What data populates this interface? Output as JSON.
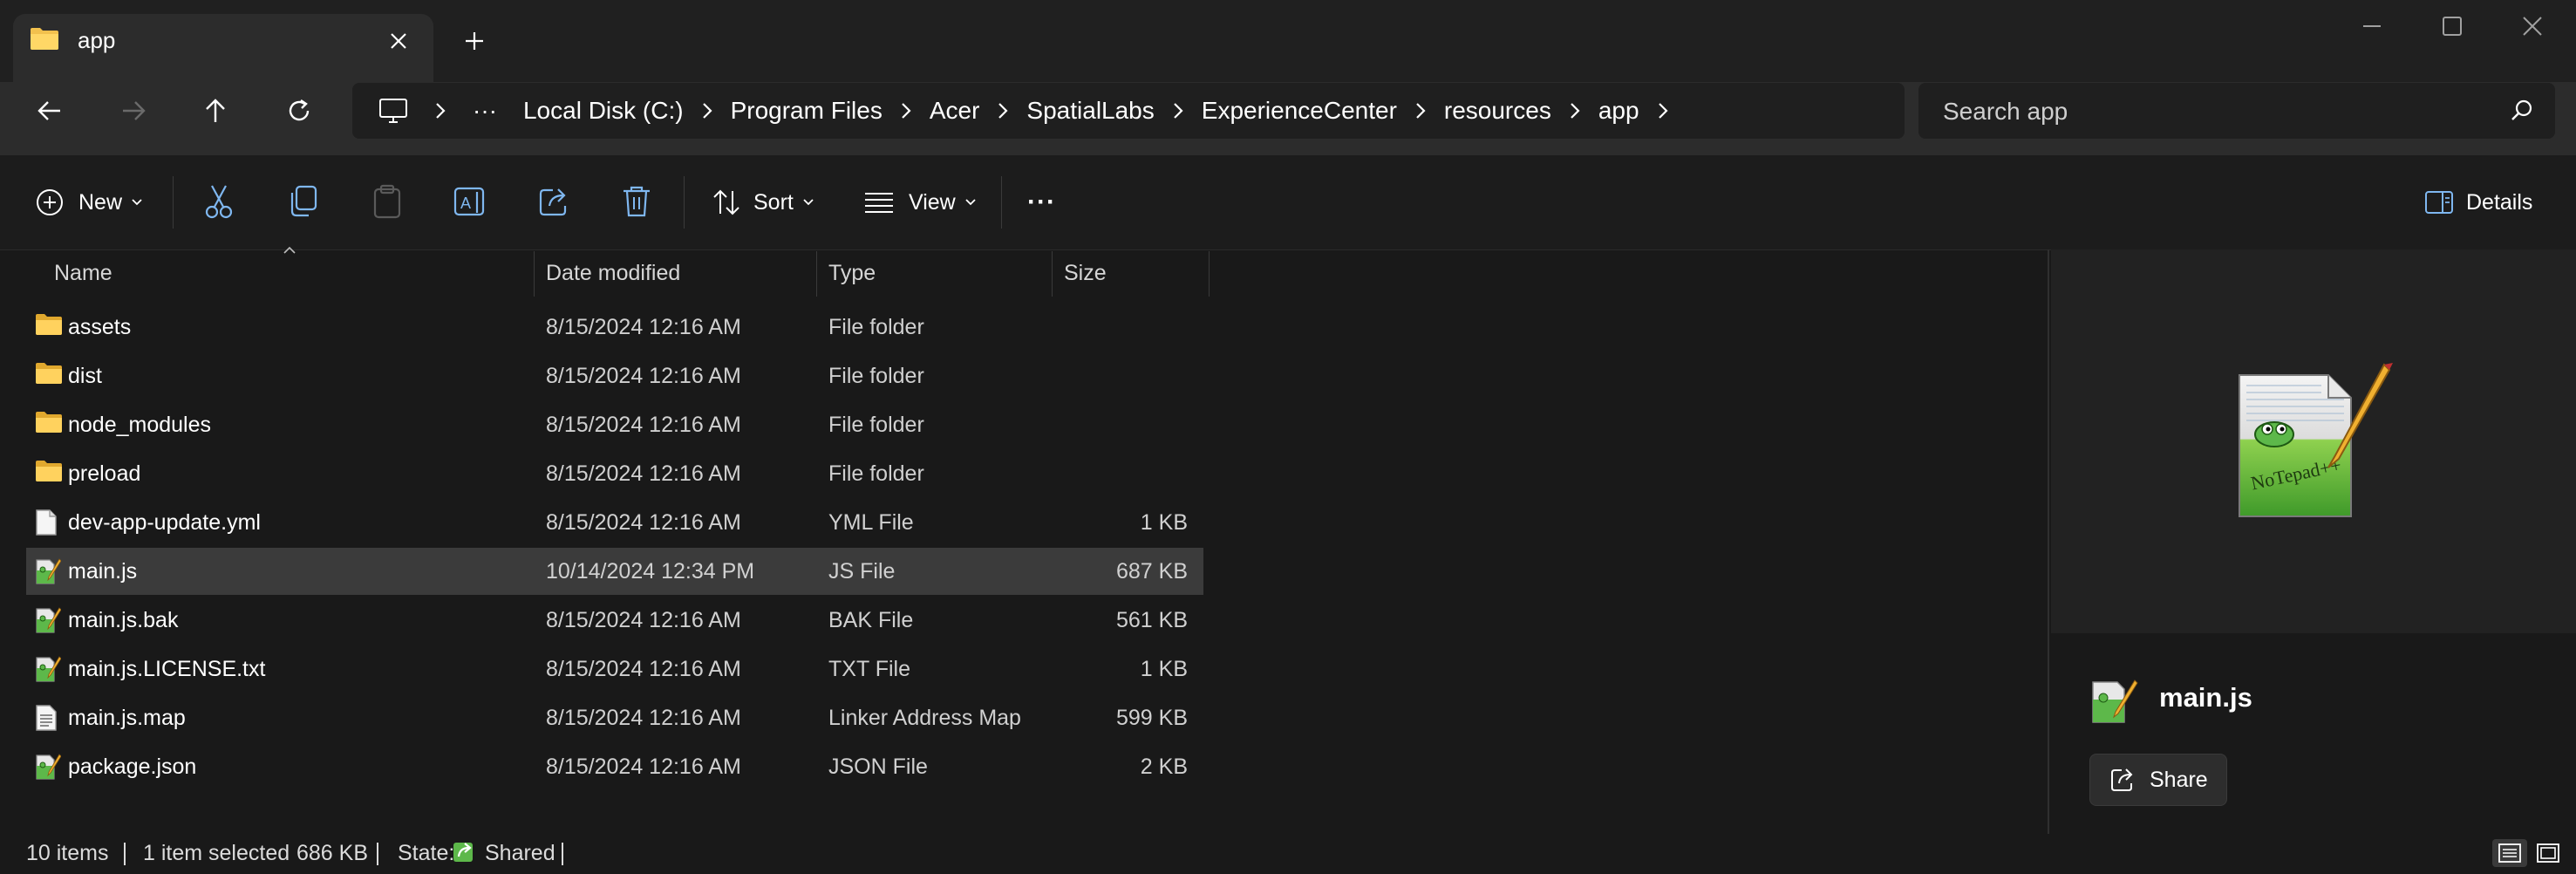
{
  "window": {
    "tab_title": "app",
    "new_tab_symbol": "+",
    "close_tab_symbol": "✕"
  },
  "breadcrumb": {
    "overflow": "···",
    "items": [
      "Local Disk (C:)",
      "Program Files",
      "Acer",
      "SpatialLabs",
      "ExperienceCenter",
      "resources",
      "app"
    ]
  },
  "search": {
    "placeholder": "Search app"
  },
  "toolbar": {
    "new_label": "New",
    "sort_label": "Sort",
    "view_label": "View",
    "more_label": "···",
    "details_label": "Details"
  },
  "columns": {
    "name": "Name",
    "date": "Date modified",
    "type": "Type",
    "size": "Size"
  },
  "files": [
    {
      "name": "assets",
      "date": "8/15/2024 12:16 AM",
      "type": "File folder",
      "size": "",
      "icon": "folder-icon"
    },
    {
      "name": "dist",
      "date": "8/15/2024 12:16 AM",
      "type": "File folder",
      "size": "",
      "icon": "folder-icon"
    },
    {
      "name": "node_modules",
      "date": "8/15/2024 12:16 AM",
      "type": "File folder",
      "size": "",
      "icon": "folder-icon"
    },
    {
      "name": "preload",
      "date": "8/15/2024 12:16 AM",
      "type": "File folder",
      "size": "",
      "icon": "folder-icon"
    },
    {
      "name": "dev-app-update.yml",
      "date": "8/15/2024 12:16 AM",
      "type": "YML File",
      "size": "1 KB",
      "icon": "file-icon"
    },
    {
      "name": "main.js",
      "date": "10/14/2024 12:34 PM",
      "type": "JS File",
      "size": "687 KB",
      "icon": "notepadpp-file-icon",
      "selected": true
    },
    {
      "name": "main.js.bak",
      "date": "8/15/2024 12:16 AM",
      "type": "BAK File",
      "size": "561 KB",
      "icon": "notepadpp-file-icon"
    },
    {
      "name": "main.js.LICENSE.txt",
      "date": "8/15/2024 12:16 AM",
      "type": "TXT File",
      "size": "1 KB",
      "icon": "notepadpp-file-icon"
    },
    {
      "name": "main.js.map",
      "date": "8/15/2024 12:16 AM",
      "type": "Linker Address Map",
      "size": "599 KB",
      "icon": "document-icon"
    },
    {
      "name": "package.json",
      "date": "8/15/2024 12:16 AM",
      "type": "JSON File",
      "size": "2 KB",
      "icon": "notepadpp-file-icon"
    }
  ],
  "details": {
    "file_name": "main.js",
    "share_label": "Share",
    "preview_logo_text": "NoTepad++"
  },
  "status": {
    "item_count": "10 items",
    "selection": "1 item selected",
    "selection_size": "686 KB",
    "state_label": "State:",
    "state_value": "Shared"
  },
  "colors": {
    "background": "#191919",
    "folder": "#f2c14e",
    "selected_row": "#3b3b3b",
    "accent_green": "#5db84a"
  }
}
